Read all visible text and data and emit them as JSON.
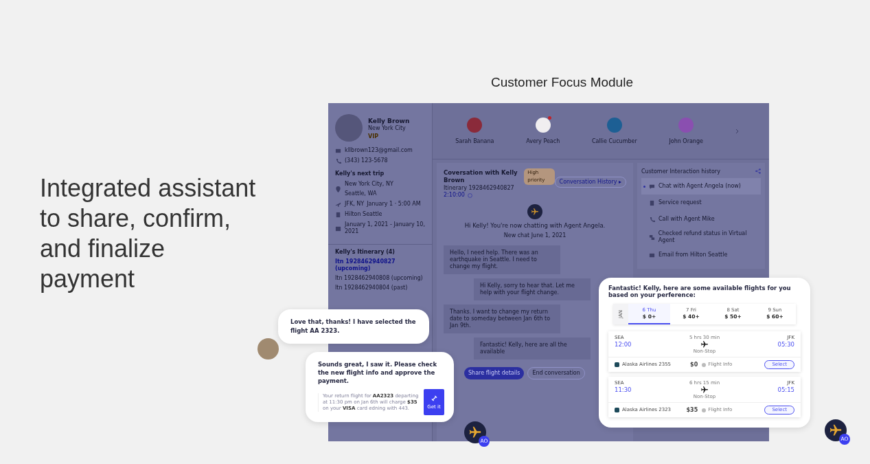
{
  "headline": "Integrated assistant to share, confirm, and finalize payment",
  "module_title": "Customer Focus Module",
  "customer": {
    "name": "Kelly Brown",
    "city": "New York City",
    "tier": "VIP",
    "email": "kllbrown123@gmail.com",
    "phone": "(343) 123-5678"
  },
  "next_trip": {
    "title": "Kelly's next trip",
    "from": "New York City, NY",
    "to": "Seattle, WA",
    "airport": "JFK, NY",
    "departure": "January 1 · 5:00 AM",
    "hotel": "Hilton Seattle",
    "dates": "January 1, 2021 - January 10, 2021"
  },
  "itinerary": {
    "title": "Kelly's Itinerary (4)",
    "items": [
      {
        "label": "Itn 1928462940827 (upcoming)",
        "selected": true
      },
      {
        "label": "Itn 1928462940808 (upcoming)",
        "selected": false
      },
      {
        "label": "Itn 1928462940804 (past)",
        "selected": false
      }
    ]
  },
  "agents": [
    {
      "name": "Sarah Banana",
      "color": "#8a2a3a",
      "notification": false
    },
    {
      "name": "Avery Peach",
      "color": "#f0eef0",
      "notification": true
    },
    {
      "name": "Callie Cucumber",
      "color": "#1d5f94",
      "notification": false
    },
    {
      "name": "John Orange",
      "color": "#8a4fb0",
      "notification": false
    }
  ],
  "conversation": {
    "title": "Coversation with Kelly Brown",
    "badge": "High priority",
    "itinerary": "Itinerary 1928462940827",
    "timer": "2:10:00",
    "history_button": "Conversation History ▸",
    "greeting": "Hi Kelly! You're now chatting with Agent Angela.",
    "started": "New chat June 1, 2021",
    "messages": [
      {
        "kind": "customer",
        "text": "Hello, I need help. There was an earthquake in Seattle. I need to change my flight."
      },
      {
        "kind": "agent",
        "text": "Hi Kelly, sorry to hear that. Let me help with your flight change."
      },
      {
        "kind": "customer",
        "text": "Thanks. I want to change my return date to someday between Jan 6th to Jan 9th."
      },
      {
        "kind": "agent",
        "text": "Fantastic! Kelly, here are all the available"
      }
    ],
    "actions": [
      {
        "label": "Share flight details",
        "kind": "primary"
      },
      {
        "label": "End conversation",
        "kind": "secondary"
      }
    ]
  },
  "history": {
    "title": "Customer Interaction history",
    "items": [
      {
        "label": "Chat with Agent Angela (now)",
        "kind": "chat",
        "selected": true
      },
      {
        "label": "Service request",
        "kind": "request",
        "selected": false
      },
      {
        "label": "Call with Agent Mike",
        "kind": "call",
        "selected": false
      },
      {
        "label": "Checked refund status in Virtual Agent",
        "kind": "virtual",
        "selected": false
      },
      {
        "label": "Email from Hilton Seattle",
        "kind": "email",
        "selected": false
      }
    ]
  },
  "chat_customer": {
    "text": "Love that, thanks! I have selected the flight AA 2323."
  },
  "chat_agent": {
    "text": "Sounds great, I saw it. Please check the new flight info and approve the payment.",
    "payment": "Your return flight for **AA2323** departing at 11:30 pm on Jan 6th will charge **$35** on your **VISA** card edning with 443.",
    "button": "Get it"
  },
  "agent_badges": [
    "AO",
    "AO"
  ],
  "flight_offer": {
    "title": "Fantastic! Kelly, here are some available flights for you based on your perference:",
    "month": "JAN",
    "dates": [
      {
        "day": "6 Thu",
        "price": "$ 0+",
        "selected": true
      },
      {
        "day": "7 Fri",
        "price": "$ 40+",
        "selected": false
      },
      {
        "day": "8 Sat",
        "price": "$ 50+",
        "selected": false
      },
      {
        "day": "9 Sun",
        "price": "$ 60+",
        "selected": false
      }
    ],
    "flights": [
      {
        "from": "SEA",
        "depart": "12:00",
        "duration": "5 hrs 30 min",
        "stops": "Non-Stop",
        "to": "JFK",
        "arrive": "05:30",
        "airline": "Alaska Airlines 2355",
        "price": "$0",
        "info": "Flight Info",
        "button": "Select"
      },
      {
        "from": "SEA",
        "depart": "11:30",
        "duration": "6 hrs 15 min",
        "stops": "Non-Stop",
        "to": "JFK",
        "arrive": "05:15",
        "airline": "Alaska Airlines 2323",
        "price": "$35",
        "info": "Flight Info",
        "button": "Select"
      }
    ]
  }
}
